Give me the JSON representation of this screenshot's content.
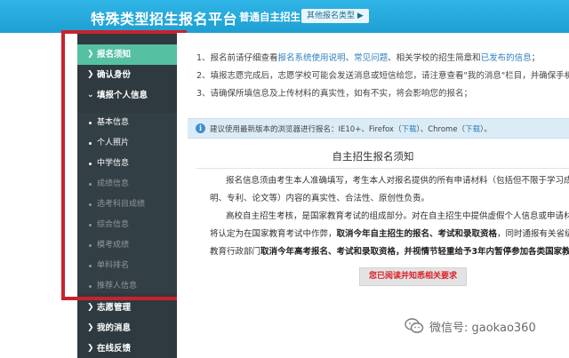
{
  "header": {
    "title": "特殊类型招生报名平台",
    "current_type": "普通自主招生",
    "other_types_button": "其他报名类型 ▶"
  },
  "sidebar": {
    "top_items": [
      {
        "label": "报名须知",
        "active": true
      },
      {
        "label": "确认身份"
      },
      {
        "label": "填报个人信息"
      }
    ],
    "sub_items": [
      {
        "label": "基本信息",
        "enabled": true
      },
      {
        "label": "个人照片",
        "enabled": true
      },
      {
        "label": "中学信息",
        "enabled": true
      },
      {
        "label": "成绩信息",
        "enabled": false
      },
      {
        "label": "选考科目成绩",
        "enabled": false
      },
      {
        "label": "综合信息",
        "enabled": false
      },
      {
        "label": "模考成绩",
        "enabled": false
      },
      {
        "label": "单科排名",
        "enabled": false
      },
      {
        "label": "推荐人信息",
        "enabled": false
      }
    ],
    "bottom_items": [
      {
        "label": "志愿管理"
      },
      {
        "label": "我的消息"
      },
      {
        "label": "在线反馈"
      }
    ]
  },
  "notices": {
    "line1_a": "1、报名前请仔细查看",
    "line1_link1": "报名系统使用说明",
    "line1_sep1": "、",
    "line1_link2": "常见问题",
    "line1_b": "、相关学校的招生简章和",
    "line1_link3": "已发布的信息",
    "line1_c": "；",
    "line2": "2、填报志愿完成后，志愿学校可能会发送消息或短信给您，请注意查看\"我的消息\"栏目，并确保手机号",
    "line3": "3、请确保所填信息及上传材料的真实性，如有不实，将会影响您的报名；"
  },
  "browser_tip": {
    "icon": "info-icon",
    "text_a": "建议使用最新版本的浏览器进行报名：IE10+、Firefox（",
    "download1": "下载",
    "text_b": "）、Chrome（",
    "download2": "下载",
    "text_c": "）。"
  },
  "content": {
    "title": "自主招生报名须知",
    "p1_l1": "报名信息须由考生本人准确填写，考生本人对报名提供的所有申请材料（包括但不限于学习成绩、",
    "p1_l2": "明、专利、论文等）内容的真实性、合法性、原创性负责。",
    "p2_l1": "高校自主招生考核，是国家教育考试的组成部分。对在自主招生中提供虚假个人信息或申请材料等",
    "p2_l2a": "将认定为在国家教育考试中作弊，",
    "p2_l2b": "取消今年自主招生的报名、考试和录取资格",
    "p2_l2c": "，同时通报有关省级招",
    "p2_l3a": "教育行政部门",
    "p2_l3b": "取消今年高考报名、考试和录取资格，并视情节轻重给予3年内暂停参加各类国家教育考",
    "agree_button": "您已阅读并知悉相关要求"
  },
  "watermark": {
    "icon": "wechat-icon",
    "text": "微信号: gaokao360"
  },
  "colors": {
    "header": "#1f9fd2",
    "sidebar": "#2e3a3f",
    "active": "#56c0a2",
    "highlight_frame": "#c8232d",
    "link": "#2d7fc2"
  }
}
